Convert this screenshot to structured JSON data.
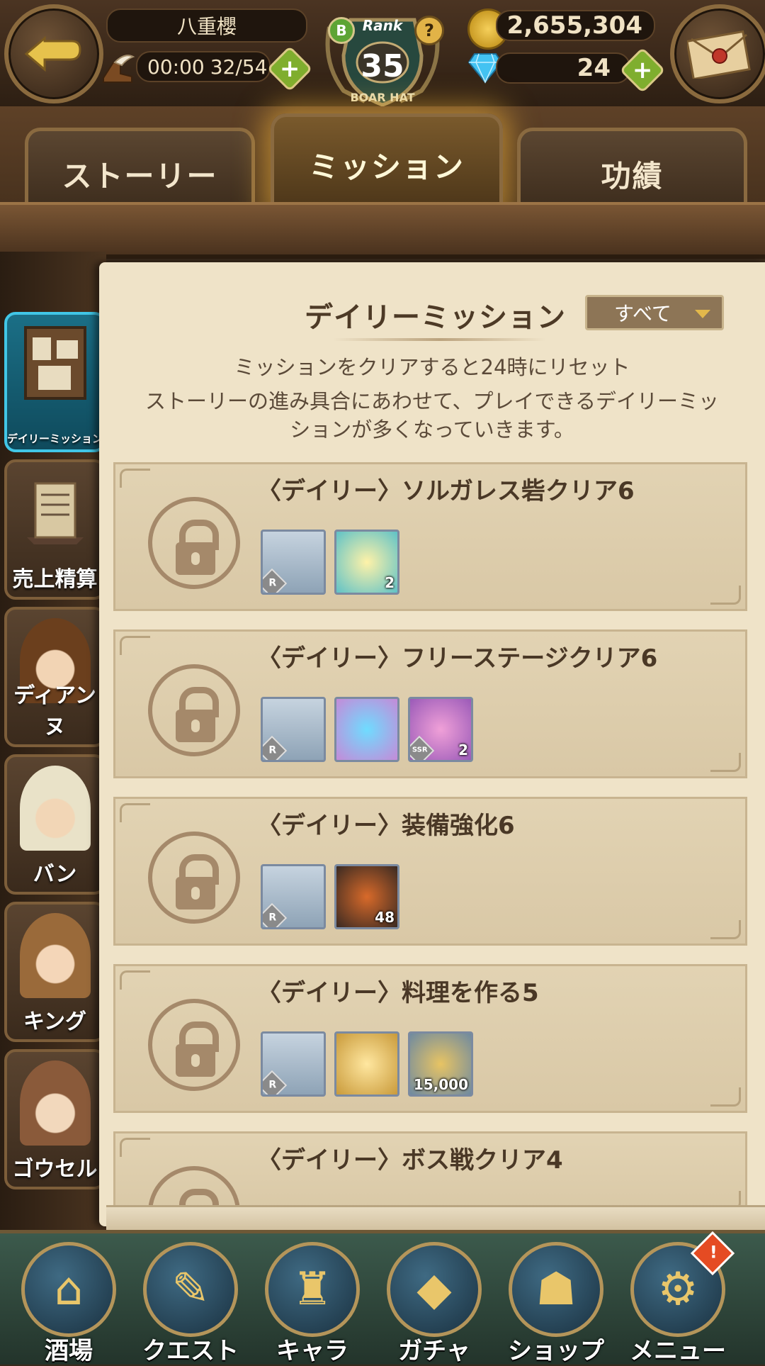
{
  "header": {
    "player_name": "八重櫻",
    "stamina_timer": "00:00",
    "stamina_value": "32/54",
    "rank_label": "Rank",
    "rank_value": "35",
    "rank_letter": "B",
    "rank_banner": "BOAR HAT",
    "help_glyph": "?",
    "gold": "2,655,304",
    "gems": "24"
  },
  "tabs": [
    {
      "label": "ストーリー",
      "active": false
    },
    {
      "label": "ミッション",
      "active": true
    },
    {
      "label": "功績",
      "active": false
    }
  ],
  "sidebar": {
    "items": [
      {
        "label": "デイリーミッション",
        "active": true
      },
      {
        "label": "売上精算"
      },
      {
        "label": "ディアンヌ"
      },
      {
        "label": "バン"
      },
      {
        "label": "キング"
      },
      {
        "label": "ゴウセル"
      }
    ]
  },
  "panel": {
    "title": "デイリーミッション",
    "filter_value": "すべて",
    "desc_line1": "ミッションをクリアすると24時にリセット",
    "desc_line2": "ストーリーの進み具合にあわせて、プレイできるデイリーミッ",
    "desc_line3": "ションが多くなっていきます。"
  },
  "missions": [
    {
      "title": "〈デイリー〉ソルガレス砦クリア6",
      "rewards": [
        {
          "icon": "pudding-dish-icon",
          "rarity": "R",
          "qty": ""
        },
        {
          "icon": "golden-potion-icon",
          "rarity": "",
          "qty": "2"
        }
      ]
    },
    {
      "title": "〈デイリー〉フリーステージクリア6",
      "rewards": [
        {
          "icon": "seafood-dish-icon",
          "rarity": "R",
          "qty": ""
        },
        {
          "icon": "diamond-gem-icon",
          "rarity": "",
          "qty": ""
        },
        {
          "icon": "treasure-chest-icon",
          "rarity": "SSR",
          "qty": "2"
        }
      ]
    },
    {
      "title": "〈デイリー〉装備強化6",
      "rewards": [
        {
          "icon": "pie-dish-icon",
          "rarity": "R",
          "qty": ""
        },
        {
          "icon": "fire-crystal-icon",
          "rarity": "",
          "qty": "48"
        }
      ]
    },
    {
      "title": "〈デイリー〉料理を作る5",
      "rewards": [
        {
          "icon": "bread-dish-icon",
          "rarity": "R",
          "qty": ""
        },
        {
          "icon": "orange-potion-icon",
          "rarity": "",
          "qty": ""
        },
        {
          "icon": "gold-coin-icon",
          "rarity": "",
          "qty": "15,000"
        }
      ]
    },
    {
      "title": "〈デイリー〉ボス戦クリア4",
      "rewards": []
    }
  ],
  "bottom_nav": [
    {
      "label": "酒場",
      "icon": "tavern-icon"
    },
    {
      "label": "クエスト",
      "icon": "scroll-icon"
    },
    {
      "label": "キャラ",
      "icon": "helmet-icon"
    },
    {
      "label": "ガチャ",
      "icon": "crystal-icon"
    },
    {
      "label": "ショップ",
      "icon": "shop-sign-icon"
    },
    {
      "label": "メニュー",
      "icon": "gear-icon",
      "badge": "!"
    }
  ]
}
